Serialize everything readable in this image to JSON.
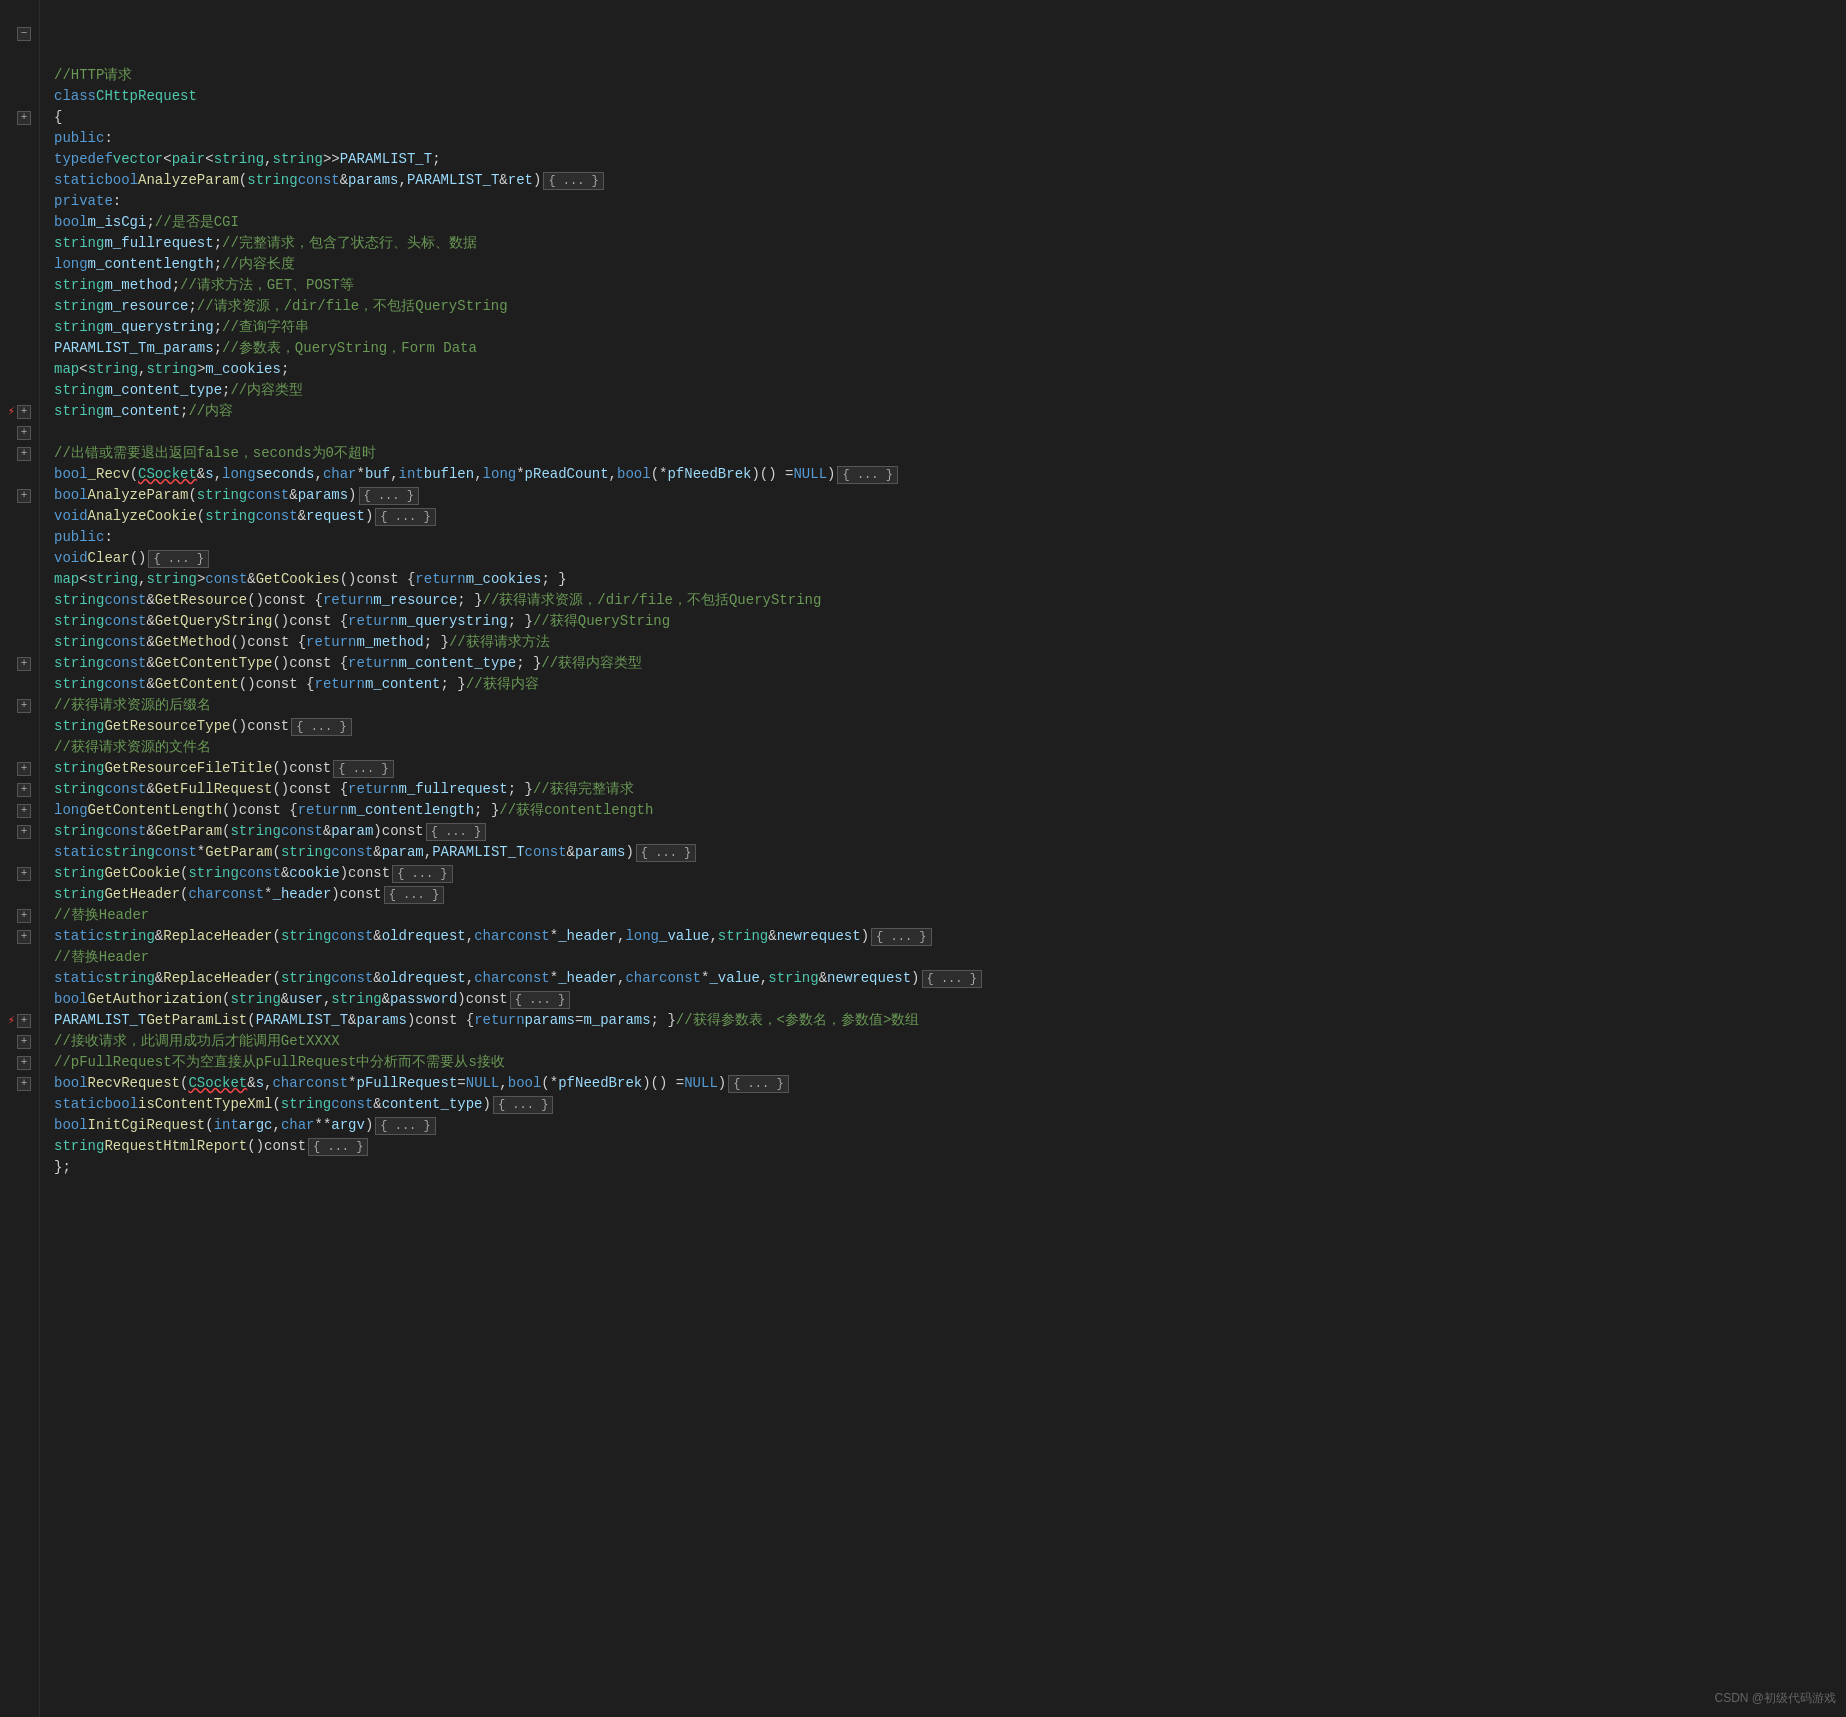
{
  "watermark": "CSDN @初级代码游戏",
  "lines": [
    {
      "gutter": "",
      "fold": "none",
      "content": "comment_http"
    },
    {
      "gutter": "",
      "fold": "minus",
      "content": "class_decl"
    },
    {
      "gutter": "",
      "fold": "none",
      "content": "open_brace"
    },
    {
      "gutter": "",
      "fold": "none",
      "content": "public_label"
    },
    {
      "gutter": "",
      "fold": "none",
      "content": "typedef_line"
    },
    {
      "gutter": "",
      "fold": "plus",
      "content": "static_bool_analyze"
    },
    {
      "gutter": "",
      "fold": "none",
      "content": "private_label"
    },
    {
      "gutter": "",
      "fold": "none",
      "content": "bool_m_iscgi"
    },
    {
      "gutter": "",
      "fold": "none",
      "content": "string_fullrequest"
    },
    {
      "gutter": "",
      "fold": "none",
      "content": "long_contentlength"
    },
    {
      "gutter": "",
      "fold": "none",
      "content": "string_method"
    },
    {
      "gutter": "",
      "fold": "none",
      "content": "string_resource"
    },
    {
      "gutter": "",
      "fold": "none",
      "content": "string_querystring"
    },
    {
      "gutter": "",
      "fold": "none",
      "content": "paramlist_params"
    },
    {
      "gutter": "",
      "fold": "none",
      "content": "map_cookies"
    },
    {
      "gutter": "",
      "fold": "none",
      "content": "string_content_type"
    },
    {
      "gutter": "",
      "fold": "none",
      "content": "string_content"
    },
    {
      "gutter": "",
      "fold": "none",
      "content": "empty1"
    },
    {
      "gutter": "",
      "fold": "none",
      "content": "comment_error"
    },
    {
      "gutter": "warn",
      "fold": "plus",
      "content": "bool_recv"
    },
    {
      "gutter": "",
      "fold": "plus",
      "content": "bool_analyzeparam"
    },
    {
      "gutter": "",
      "fold": "plus",
      "content": "void_analyzecookie"
    },
    {
      "gutter": "",
      "fold": "none",
      "content": "public2_label"
    },
    {
      "gutter": "",
      "fold": "plus",
      "content": "void_clear"
    },
    {
      "gutter": "",
      "fold": "none",
      "content": "map_getcookies"
    },
    {
      "gutter": "",
      "fold": "none",
      "content": "string_getresource"
    },
    {
      "gutter": "",
      "fold": "none",
      "content": "string_getquerystring"
    },
    {
      "gutter": "",
      "fold": "none",
      "content": "string_getmethod"
    },
    {
      "gutter": "",
      "fold": "none",
      "content": "string_getcontenttype"
    },
    {
      "gutter": "",
      "fold": "none",
      "content": "string_getcontent"
    },
    {
      "gutter": "",
      "fold": "none",
      "content": "comment_suffix"
    },
    {
      "gutter": "",
      "fold": "plus",
      "content": "string_getresourcetype"
    },
    {
      "gutter": "",
      "fold": "none",
      "content": "comment_filename"
    },
    {
      "gutter": "",
      "fold": "plus",
      "content": "string_getresourcefiletitle"
    },
    {
      "gutter": "",
      "fold": "none",
      "content": "string_getfullrequest"
    },
    {
      "gutter": "",
      "fold": "none",
      "content": "long_getcontentlength"
    },
    {
      "gutter": "",
      "fold": "plus",
      "content": "string_getparam1"
    },
    {
      "gutter": "",
      "fold": "plus",
      "content": "static_getparam2"
    },
    {
      "gutter": "",
      "fold": "plus",
      "content": "string_getcookie"
    },
    {
      "gutter": "",
      "fold": "plus",
      "content": "string_getheader"
    },
    {
      "gutter": "",
      "fold": "none",
      "content": "comment_replace1"
    },
    {
      "gutter": "",
      "fold": "plus",
      "content": "static_replaceheader1"
    },
    {
      "gutter": "",
      "fold": "none",
      "content": "comment_replace2"
    },
    {
      "gutter": "",
      "fold": "plus",
      "content": "static_replaceheader2"
    },
    {
      "gutter": "",
      "fold": "plus",
      "content": "bool_getauthorization"
    },
    {
      "gutter": "",
      "fold": "none",
      "content": "paramlist_getparamlist"
    },
    {
      "gutter": "",
      "fold": "none",
      "content": "comment_recv1"
    },
    {
      "gutter": "",
      "fold": "none",
      "content": "comment_recv2"
    },
    {
      "gutter": "warn",
      "fold": "plus",
      "content": "bool_recvrequest"
    },
    {
      "gutter": "",
      "fold": "plus",
      "content": "static_iscontenttypexml"
    },
    {
      "gutter": "",
      "fold": "plus",
      "content": "bool_initcgirequest"
    },
    {
      "gutter": "",
      "fold": "plus",
      "content": "string_requesthtmlreport"
    },
    {
      "gutter": "",
      "fold": "none",
      "content": "close_brace"
    }
  ]
}
